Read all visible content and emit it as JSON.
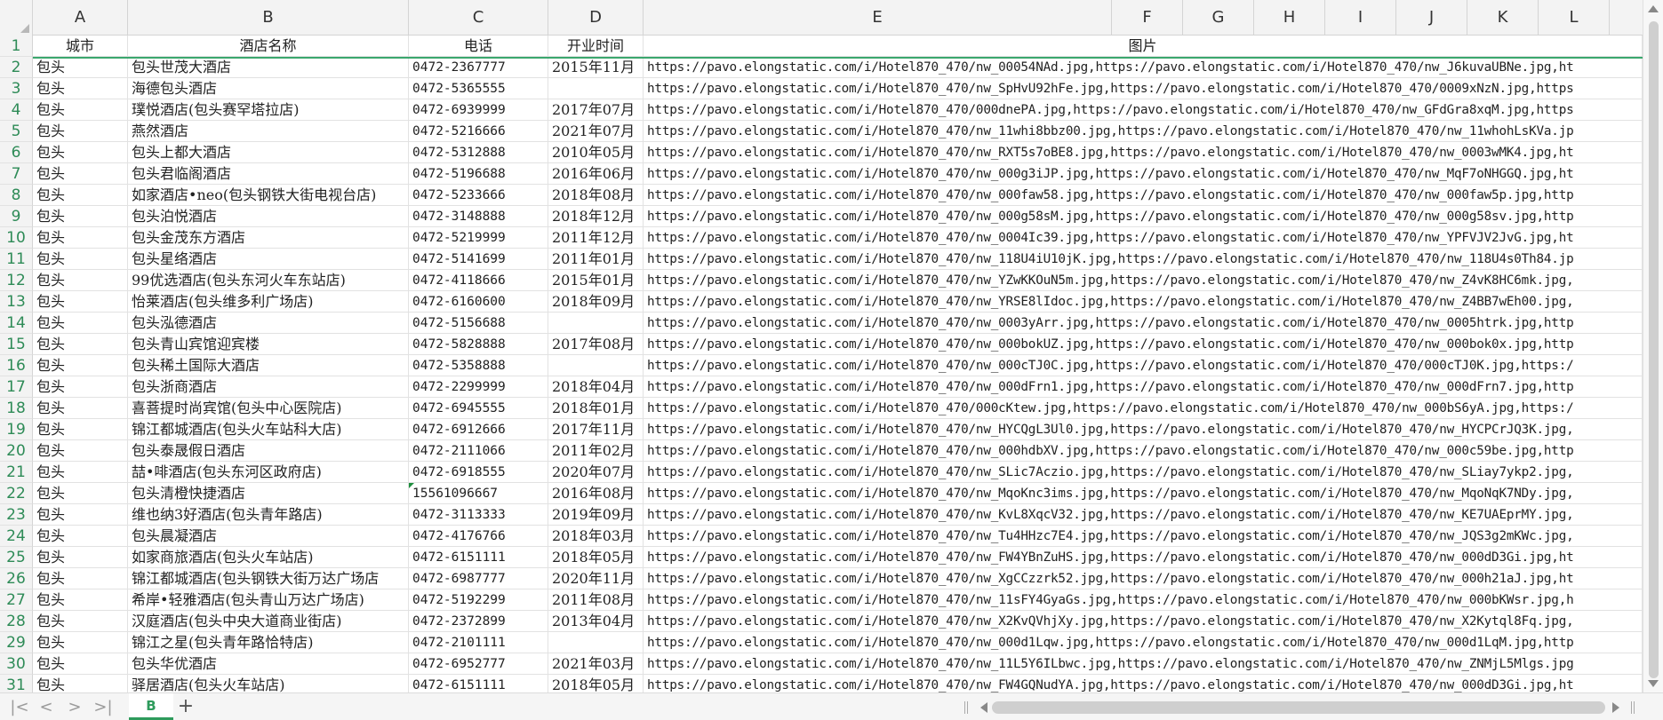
{
  "sheet": {
    "columns": [
      "A",
      "B",
      "C",
      "D",
      "E",
      "F",
      "G",
      "H",
      "I",
      "J",
      "K",
      "L"
    ],
    "header_row": [
      "城市",
      "酒店名称",
      "电话",
      "开业时间",
      "图片"
    ],
    "rows": [
      {
        "n": "1",
        "a": "",
        "b": "",
        "c": "",
        "d": "",
        "e": ""
      },
      {
        "n": "2",
        "a": "包头",
        "b": "包头世茂大酒店",
        "c": "0472-2367777",
        "d": "2015年11月",
        "e": "https://pavo.elongstatic.com/i/Hotel870_470/nw_00054NAd.jpg,https://pavo.elongstatic.com/i/Hotel870_470/nw_J6kuvaUBNe.jpg,ht"
      },
      {
        "n": "3",
        "a": "包头",
        "b": "海德包头酒店",
        "c": "0472-5365555",
        "d": "",
        "e": "https://pavo.elongstatic.com/i/Hotel870_470/nw_SpHvU92hFe.jpg,https://pavo.elongstatic.com/i/Hotel870_470/0009xNzN.jpg,https"
      },
      {
        "n": "4",
        "a": "包头",
        "b": "璞悦酒店(包头赛罕塔拉店)",
        "c": "0472-6939999",
        "d": "2017年07月",
        "e": "https://pavo.elongstatic.com/i/Hotel870_470/000dnePA.jpg,https://pavo.elongstatic.com/i/Hotel870_470/nw_GFdGra8xqM.jpg,https"
      },
      {
        "n": "5",
        "a": "包头",
        "b": "燕然酒店",
        "c": "0472-5216666",
        "d": "2021年07月",
        "e": "https://pavo.elongstatic.com/i/Hotel870_470/nw_11whi8bbz00.jpg,https://pavo.elongstatic.com/i/Hotel870_470/nw_11whohLsKVa.jp"
      },
      {
        "n": "6",
        "a": "包头",
        "b": "包头上都大酒店",
        "c": "0472-5312888",
        "d": "2010年05月",
        "e": "https://pavo.elongstatic.com/i/Hotel870_470/nw_RXT5s7oBE8.jpg,https://pavo.elongstatic.com/i/Hotel870_470/nw_0003wMK4.jpg,ht"
      },
      {
        "n": "7",
        "a": "包头",
        "b": "包头君临阁酒店",
        "c": "0472-5196688",
        "d": "2016年06月",
        "e": "https://pavo.elongstatic.com/i/Hotel870_470/nw_000g3iJP.jpg,https://pavo.elongstatic.com/i/Hotel870_470/nw_MqF7oNHGGQ.jpg,ht"
      },
      {
        "n": "8",
        "a": "包头",
        "b": "如家酒店•neo(包头钢铁大街电视台店)",
        "c": "0472-5233666",
        "d": "2018年08月",
        "e": "https://pavo.elongstatic.com/i/Hotel870_470/nw_000faw58.jpg,https://pavo.elongstatic.com/i/Hotel870_470/nw_000faw5p.jpg,http"
      },
      {
        "n": "9",
        "a": "包头",
        "b": "包头泊悦酒店",
        "c": "0472-3148888",
        "d": "2018年12月",
        "e": "https://pavo.elongstatic.com/i/Hotel870_470/nw_000g58sM.jpg,https://pavo.elongstatic.com/i/Hotel870_470/nw_000g58sv.jpg,http"
      },
      {
        "n": "10",
        "a": "包头",
        "b": "包头金茂东方酒店",
        "c": "0472-5219999",
        "d": "2011年12月",
        "e": "https://pavo.elongstatic.com/i/Hotel870_470/nw_0004Ic39.jpg,https://pavo.elongstatic.com/i/Hotel870_470/nw_YPFVJV2JvG.jpg,ht"
      },
      {
        "n": "11",
        "a": "包头",
        "b": "包头星络酒店",
        "c": "0472-5141699",
        "d": "2011年01月",
        "e": "https://pavo.elongstatic.com/i/Hotel870_470/nw_118U4iU10jK.jpg,https://pavo.elongstatic.com/i/Hotel870_470/nw_118U4s0Th84.jp"
      },
      {
        "n": "12",
        "a": "包头",
        "b": "99优选酒店(包头东河火车东站店)",
        "c": "0472-4118666",
        "d": "2015年01月",
        "e": "https://pavo.elongstatic.com/i/Hotel870_470/nw_YZwKKOuN5m.jpg,https://pavo.elongstatic.com/i/Hotel870_470/nw_Z4vK8HC6mk.jpg,"
      },
      {
        "n": "13",
        "a": "包头",
        "b": "怡莱酒店(包头维多利广场店)",
        "c": "0472-6160600",
        "d": "2018年09月",
        "e": "https://pavo.elongstatic.com/i/Hotel870_470/nw_YRSE8lIdoc.jpg,https://pavo.elongstatic.com/i/Hotel870_470/nw_Z4BB7wEh00.jpg,"
      },
      {
        "n": "14",
        "a": "包头",
        "b": "包头泓德酒店",
        "c": "0472-5156688",
        "d": "",
        "e": "https://pavo.elongstatic.com/i/Hotel870_470/nw_0003yArr.jpg,https://pavo.elongstatic.com/i/Hotel870_470/nw_0005htrk.jpg,http"
      },
      {
        "n": "15",
        "a": "包头",
        "b": "包头青山宾馆迎宾楼",
        "c": "0472-5828888",
        "d": "2017年08月",
        "e": "https://pavo.elongstatic.com/i/Hotel870_470/nw_000bokUZ.jpg,https://pavo.elongstatic.com/i/Hotel870_470/nw_000bok0x.jpg,http"
      },
      {
        "n": "16",
        "a": "包头",
        "b": "包头稀土国际大酒店",
        "c": "0472-5358888",
        "d": "",
        "e": "https://pavo.elongstatic.com/i/Hotel870_470/nw_000cTJ0C.jpg,https://pavo.elongstatic.com/i/Hotel870_470/000cTJ0K.jpg,https:/"
      },
      {
        "n": "17",
        "a": "包头",
        "b": "包头浙商酒店",
        "c": "0472-2299999",
        "d": "2018年04月",
        "e": "https://pavo.elongstatic.com/i/Hotel870_470/nw_000dFrn1.jpg,https://pavo.elongstatic.com/i/Hotel870_470/nw_000dFrn7.jpg,http"
      },
      {
        "n": "18",
        "a": "包头",
        "b": "喜菩提时尚宾馆(包头中心医院店)",
        "c": "0472-6945555",
        "d": "2018年01月",
        "e": "https://pavo.elongstatic.com/i/Hotel870_470/000cKtew.jpg,https://pavo.elongstatic.com/i/Hotel870_470/nw_000bS6yA.jpg,https:/"
      },
      {
        "n": "19",
        "a": "包头",
        "b": "锦江都城酒店(包头火车站科大店)",
        "c": "0472-6912666",
        "d": "2017年11月",
        "e": "https://pavo.elongstatic.com/i/Hotel870_470/nw_HYCQgL3Ul0.jpg,https://pavo.elongstatic.com/i/Hotel870_470/nw_HYCPCrJQ3K.jpg,"
      },
      {
        "n": "20",
        "a": "包头",
        "b": "包头泰晟假日酒店",
        "c": "0472-2111066",
        "d": "2011年02月",
        "e": "https://pavo.elongstatic.com/i/Hotel870_470/nw_000hdbXV.jpg,https://pavo.elongstatic.com/i/Hotel870_470/nw_000c59be.jpg,http"
      },
      {
        "n": "21",
        "a": "包头",
        "b": "喆•啡酒店(包头东河区政府店)",
        "c": "0472-6918555",
        "d": "2020年07月",
        "e": "https://pavo.elongstatic.com/i/Hotel870_470/nw_SLic7Aczio.jpg,https://pavo.elongstatic.com/i/Hotel870_470/nw_SLiay7ykp2.jpg,"
      },
      {
        "n": "22",
        "a": "包头",
        "b": "包头清橙快捷酒店",
        "c": "15561096667",
        "d": "2016年08月",
        "e": "https://pavo.elongstatic.com/i/Hotel870_470/nw_MqoKnc3ims.jpg,https://pavo.elongstatic.com/i/Hotel870_470/nw_MqoNqK7NDy.jpg,"
      },
      {
        "n": "23",
        "a": "包头",
        "b": "维也纳3好酒店(包头青年路店)",
        "c": "0472-3113333",
        "d": "2019年09月",
        "e": "https://pavo.elongstatic.com/i/Hotel870_470/nw_KvL8XqcV32.jpg,https://pavo.elongstatic.com/i/Hotel870_470/nw_KE7UAEprMY.jpg,"
      },
      {
        "n": "24",
        "a": "包头",
        "b": "包头晨凝酒店",
        "c": "0472-4176766",
        "d": "2018年03月",
        "e": "https://pavo.elongstatic.com/i/Hotel870_470/nw_Tu4HHzc7E4.jpg,https://pavo.elongstatic.com/i/Hotel870_470/nw_JQS3g2mKWc.jpg,"
      },
      {
        "n": "25",
        "a": "包头",
        "b": "如家商旅酒店(包头火车站店)",
        "c": "0472-6151111",
        "d": "2018年05月",
        "e": "https://pavo.elongstatic.com/i/Hotel870_470/nw_FW4YBnZuHS.jpg,https://pavo.elongstatic.com/i/Hotel870_470/nw_000dD3Gi.jpg,ht"
      },
      {
        "n": "26",
        "a": "包头",
        "b": "锦江都城酒店(包头钢铁大街万达广场店",
        "c": "0472-6987777",
        "d": "2020年11月",
        "e": "https://pavo.elongstatic.com/i/Hotel870_470/nw_XgCCzzrk52.jpg,https://pavo.elongstatic.com/i/Hotel870_470/nw_000h21aJ.jpg,ht"
      },
      {
        "n": "27",
        "a": "包头",
        "b": "希岸•轻雅酒店(包头青山万达广场店)",
        "c": "0472-5192299",
        "d": "2011年08月",
        "e": "https://pavo.elongstatic.com/i/Hotel870_470/nw_11sFY4GyaGs.jpg,https://pavo.elongstatic.com/i/Hotel870_470/nw_000bKWsr.jpg,h"
      },
      {
        "n": "28",
        "a": "包头",
        "b": "汉庭酒店(包头中央大道商业街店)",
        "c": "0472-2372899",
        "d": "2013年04月",
        "e": "https://pavo.elongstatic.com/i/Hotel870_470/nw_X2KvQVhjXy.jpg,https://pavo.elongstatic.com/i/Hotel870_470/nw_X2Kytql8Fq.jpg,"
      },
      {
        "n": "29",
        "a": "包头",
        "b": "锦江之星(包头青年路恰特店)",
        "c": "0472-2101111",
        "d": "",
        "e": "https://pavo.elongstatic.com/i/Hotel870_470/nw_000d1Lqw.jpg,https://pavo.elongstatic.com/i/Hotel870_470/nw_000d1LqM.jpg,http"
      },
      {
        "n": "30",
        "a": "包头",
        "b": "包头华优酒店",
        "c": "0472-6952777",
        "d": "2021年03月",
        "e": "https://pavo.elongstatic.com/i/Hotel870_470/nw_11L5Y6ILbwc.jpg,https://pavo.elongstatic.com/i/Hotel870_470/nw_ZNMjL5Mlgs.jpg"
      },
      {
        "n": "31",
        "a": "包头",
        "b": "驿居酒店(包头火车站店)",
        "c": "0472-6151111",
        "d": "2018年05月",
        "e": "https://pavo.elongstatic.com/i/Hotel870_470/nw_FW4GQNudYA.jpg,https://pavo.elongstatic.com/i/Hotel870_470/nw_000dD3Gi.jpg,ht"
      }
    ]
  },
  "tabs": {
    "active": "B",
    "nav": [
      "|<",
      "<",
      ">",
      ">|"
    ],
    "add": "+"
  },
  "colors": {
    "accent": "#2e9b5c",
    "row_number": "#2e8b57",
    "header_bg": "#f3f3f3"
  }
}
